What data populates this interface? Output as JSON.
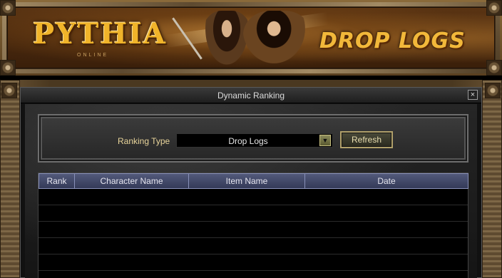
{
  "banner": {
    "logo_text": "PYTHIA",
    "logo_subtitle": "ONLINE",
    "title": "DROP LOGS"
  },
  "window": {
    "title": "Dynamic Ranking",
    "close_label": "×"
  },
  "controls": {
    "ranking_type_label": "Ranking Type",
    "ranking_type_value": "Drop Logs",
    "dropdown_arrow": "▼",
    "refresh_label": "Refresh"
  },
  "table": {
    "columns": [
      "Rank",
      "Character Name",
      "Item Name",
      "Date"
    ],
    "rows": []
  },
  "icons": {
    "close": "close-icon",
    "dropdown": "chevron-down-icon"
  }
}
